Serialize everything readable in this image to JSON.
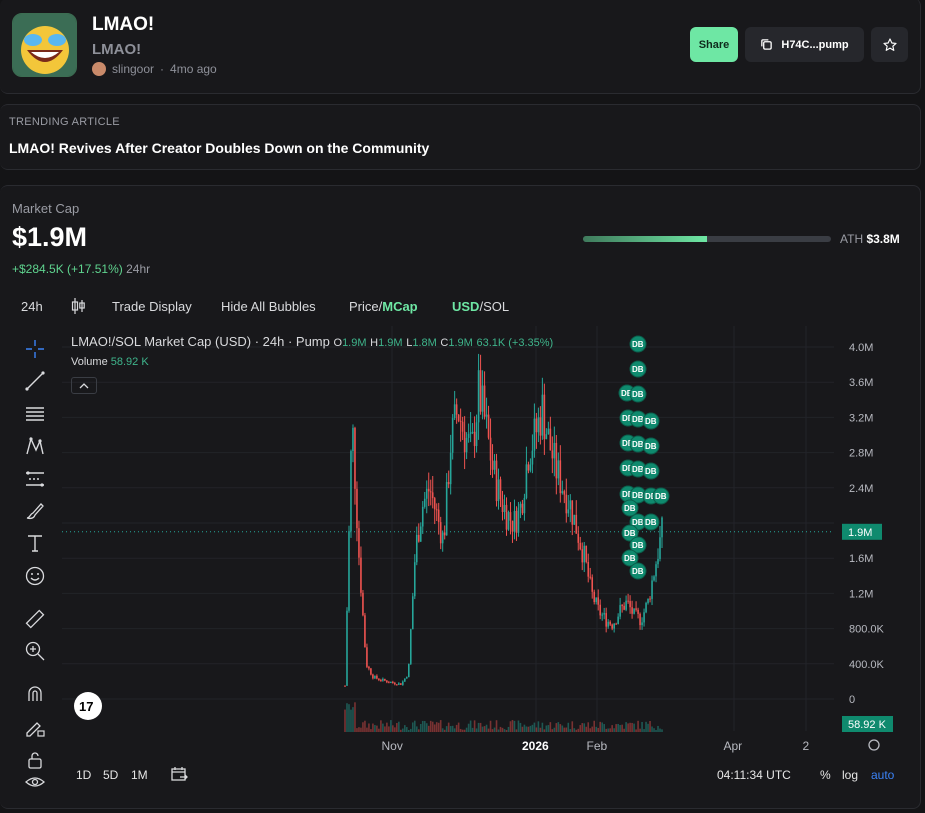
{
  "token": {
    "name": "LMAO!",
    "ticker": "LMAO!",
    "creator": "slingoor",
    "age": "4mo ago"
  },
  "header_actions": {
    "share_label": "Share",
    "address_label": "H74C...pump"
  },
  "trending": {
    "label": "TRENDING ARTICLE",
    "title": "LMAO! Revives After Creator Doubles Down on the Community"
  },
  "market": {
    "label": "Market Cap",
    "value": "$1.9M",
    "change": "+$284.5K (+17.51%)",
    "period": "24hr",
    "ath_label": "ATH",
    "ath_value": "$3.8M",
    "ath_progress": 0.5
  },
  "toolbar": {
    "interval": "24h",
    "trade_display": "Trade Display",
    "hide_bubbles": "Hide All Bubbles",
    "price_label": "Price/",
    "mcap_label": "MCap",
    "usd_label": "USD",
    "sol_label": "/SOL"
  },
  "chart_legend": {
    "title": "LMAO!/SOL Market Cap (USD) · 24h · Pump",
    "o_key": "O",
    "o_val": "1.9M",
    "h_key": "H",
    "h_val": "1.9M",
    "l_key": "L",
    "l_val": "1.8M",
    "c_key": "C",
    "c_val": "1.9M",
    "change": "63.1K (+3.35%)",
    "volume_label": "Volume",
    "volume_value": "58.92 K"
  },
  "chart_data": {
    "type": "candlestick",
    "y_tick_labels": [
      "4.0M",
      "3.6M",
      "3.2M",
      "2.8M",
      "2.4M",
      "1.9M",
      "1.6M",
      "1.2M",
      "800.0K",
      "400.0K",
      "0"
    ],
    "x_tick_labels": [
      "Nov",
      "2026",
      "Feb",
      "Apr",
      "2"
    ],
    "current_value_label": "1.9M",
    "volume_tag": "58.92 K",
    "bubble_label": "DB",
    "ylim": [
      0,
      4000000
    ],
    "close_series": [
      150000,
      3200000,
      1600000,
      400000,
      250000,
      220000,
      200000,
      180000,
      170000,
      300000,
      1700000,
      2200000,
      2400000,
      2100000,
      1800000,
      2900000,
      3300000,
      3000000,
      2800000,
      3500000,
      3100000,
      2600000,
      2300000,
      2100000,
      2000000,
      2200000,
      2800000,
      3000000,
      3300000,
      2900000,
      2600000,
      2400000,
      2200000,
      1900000,
      1600000,
      1200000,
      1000000,
      900000,
      850000,
      1000000,
      1100000,
      950000,
      900000,
      1100000,
      1500000,
      1900000
    ]
  },
  "bottom_bar": {
    "range_1d": "1D",
    "range_5d": "5D",
    "range_1m": "1M",
    "time": "04:11:34 UTC",
    "percent": "%",
    "log": "log",
    "auto": "auto"
  },
  "colors": {
    "up": "#26a69a",
    "down": "#ef5350",
    "accent": "#6ee7a4"
  }
}
